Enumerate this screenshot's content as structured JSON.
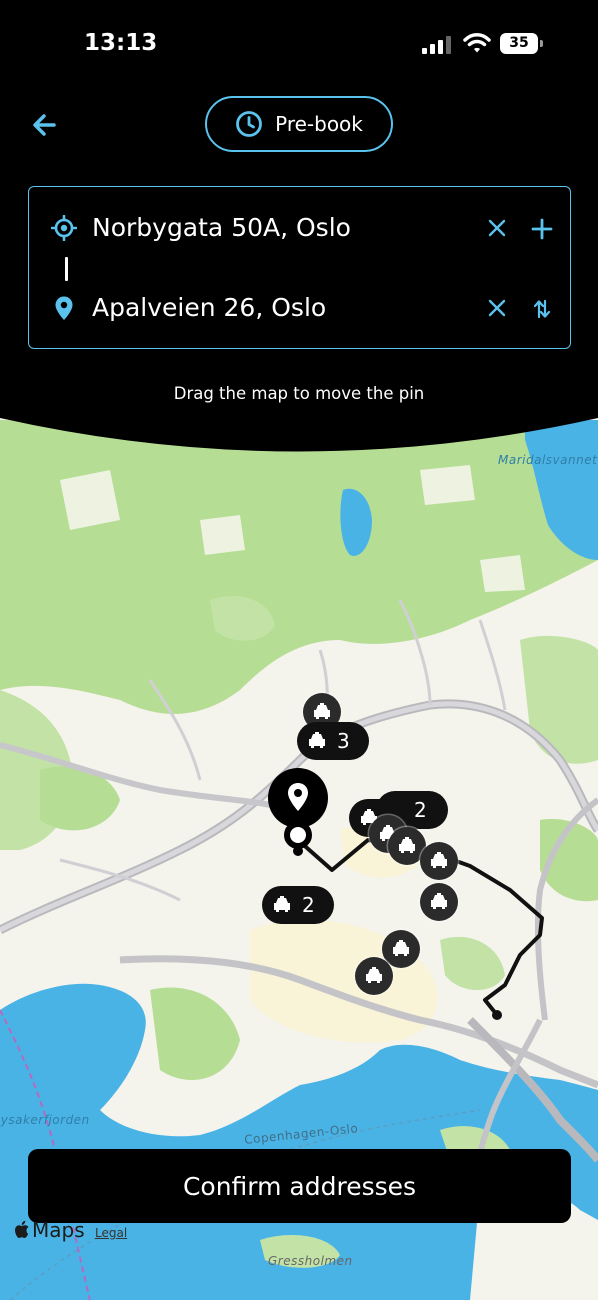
{
  "status_bar": {
    "time": "13:13",
    "battery": "35"
  },
  "header": {
    "prebook_label": "Pre-book"
  },
  "addresses": {
    "from": "Norbygata 50A, Oslo",
    "to": "Apalveien 26, Oslo"
  },
  "map_hint": "Drag the map to move the pin",
  "map": {
    "labels": {
      "maridalsvannet": "Maridalsvannet",
      "lysakerfjorden": "Lysakerfjorden",
      "copenhagen_oslo": "Copenhagen-Oslo",
      "gressholmen": "Gressholmen"
    },
    "clusters": [
      {
        "count": "3"
      },
      {
        "count": "3"
      },
      {
        "count": "2"
      },
      {
        "count": "2"
      }
    ]
  },
  "confirm_label": "Confirm addresses",
  "attribution": {
    "maps_label": "Maps",
    "legal_label": "Legal"
  },
  "colors": {
    "accent": "#5bc2ee",
    "background": "#000000",
    "map_land": "#f4f3ec",
    "map_forest": "#b6dd94",
    "map_water": "#4ab3e6"
  }
}
